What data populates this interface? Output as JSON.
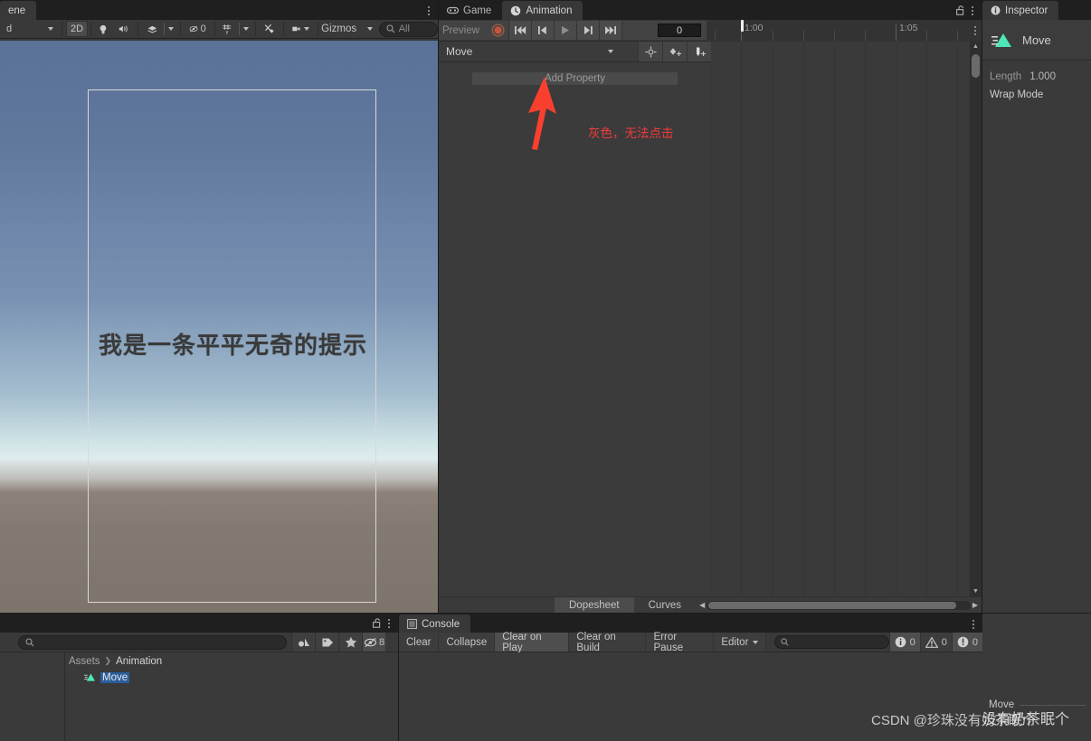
{
  "scene": {
    "tab_label": "ene",
    "toolbar": {
      "shading_mode": "d",
      "mode_2d": "2D",
      "gizmo_count": "0",
      "gizmos_label": "Gizmos",
      "search_placeholder": "All"
    },
    "game_view_text": "我是一条平平无奇的提示"
  },
  "animation": {
    "tabs": [
      {
        "label": "Game",
        "icon": "gamepad-icon",
        "active": false
      },
      {
        "label": "Animation",
        "icon": "clock-icon",
        "active": true
      }
    ],
    "preview_label": "Preview",
    "frame_value": "0",
    "clip_name": "Move",
    "add_property_label": "Add Property",
    "timeline": {
      "labels": [
        "1:00",
        "1:05"
      ],
      "playhead_frame": "0"
    },
    "mode_tabs": [
      {
        "label": "Dopesheet",
        "active": true
      },
      {
        "label": "Curves",
        "active": false
      }
    ]
  },
  "inspector": {
    "tab_label": "Inspector",
    "asset_name": "Move",
    "length_label": "Length",
    "length_value": "1.000",
    "wrap_mode_label": "Wrap Mode",
    "footer_title": "Move"
  },
  "project": {
    "search_placeholder": "",
    "hidden_count": "8",
    "breadcrumb": [
      "Assets",
      "Animation"
    ],
    "asset_name": "Move"
  },
  "console": {
    "tab_label": "Console",
    "buttons": [
      {
        "label": "Clear",
        "on": false
      },
      {
        "label": "Collapse",
        "on": false
      },
      {
        "label": "Clear on Play",
        "on": true
      },
      {
        "label": "Clear on Build",
        "on": false
      },
      {
        "label": "Error Pause",
        "on": false
      },
      {
        "label": "Editor",
        "on": false
      }
    ],
    "search_placeholder": "",
    "counts": {
      "log": "0",
      "warning": "0",
      "error": "0"
    }
  },
  "annotation": {
    "text": "灰色，无法点击",
    "color": "#f33a3a"
  },
  "watermark": {
    "text": "CSDN @珍珠没有奶茶眠个",
    "overlay": "没有奶茶眠个"
  }
}
